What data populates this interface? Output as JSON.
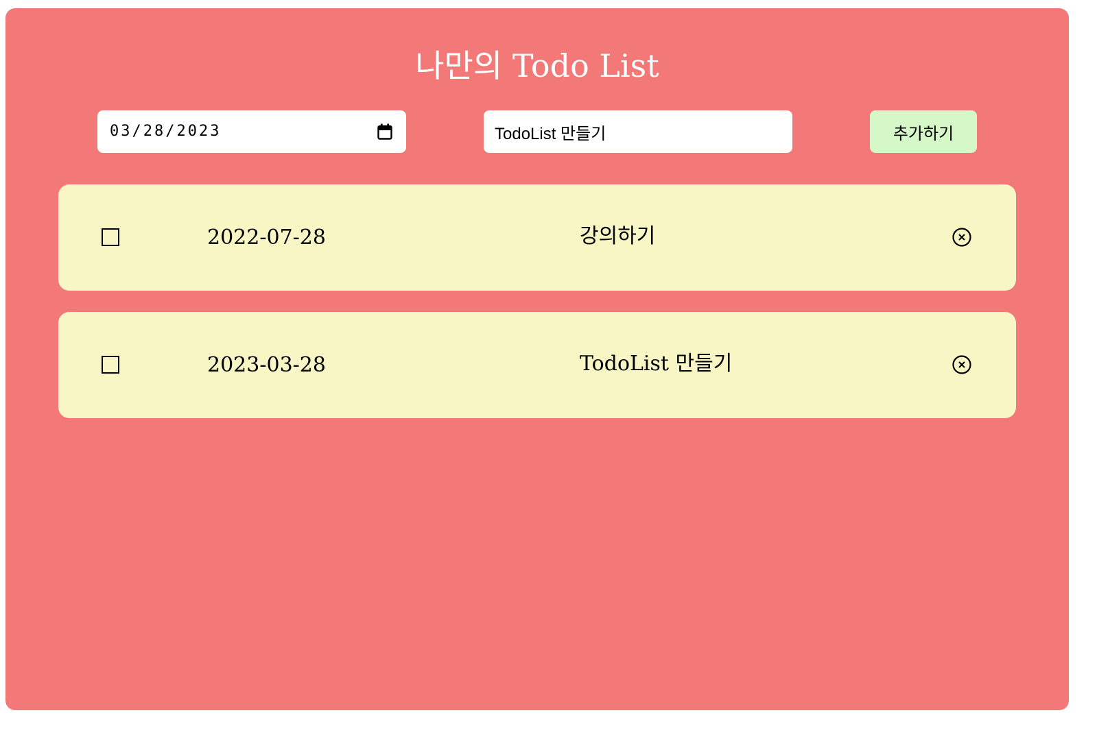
{
  "header": {
    "title": "나만의 Todo List"
  },
  "form": {
    "date_value": "03/28/2023",
    "text_value": "TodoList 만들기",
    "add_label": "추가하기"
  },
  "todos": [
    {
      "date": "2022-07-28",
      "text": "강의하기",
      "checked": false
    },
    {
      "date": "2023-03-28",
      "text": "TodoList 만들기",
      "checked": false
    }
  ],
  "colors": {
    "background": "#f37878",
    "item_background": "#f7f6c4",
    "button_background": "#d6f7c8",
    "title_text": "#ffffff"
  },
  "icons": {
    "date_picker": "calendar-icon",
    "delete": "close-circle-icon",
    "checkbox": "checkbox-icon"
  }
}
